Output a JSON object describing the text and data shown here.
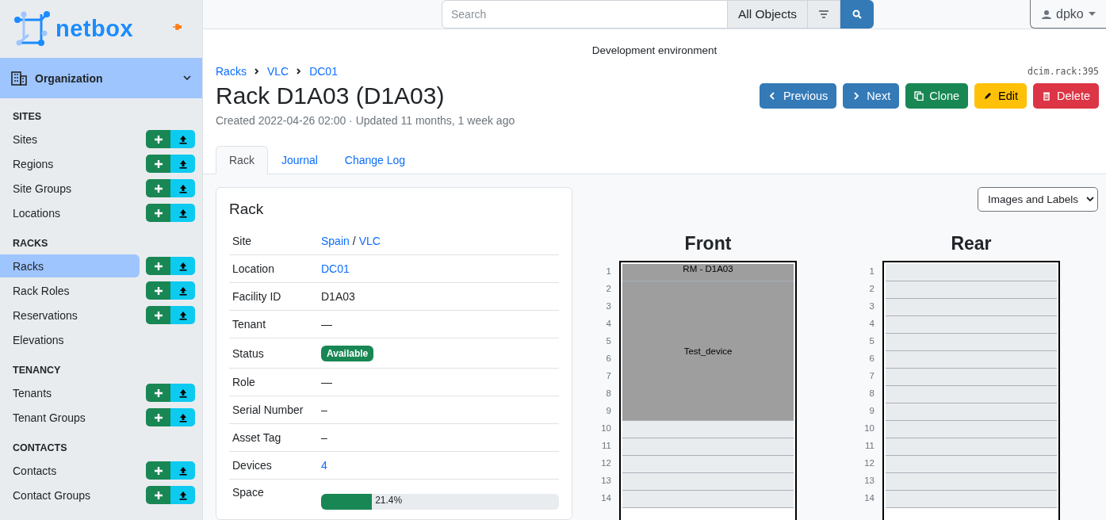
{
  "logo": {
    "text": "netbox"
  },
  "sidebar": {
    "menu": {
      "label": "Organization",
      "expanded": true
    },
    "sections": [
      {
        "heading": "SITES",
        "items": [
          {
            "label": "Sites",
            "selected": false,
            "actions": true
          },
          {
            "label": "Regions",
            "selected": false,
            "actions": true
          },
          {
            "label": "Site Groups",
            "selected": false,
            "actions": true
          },
          {
            "label": "Locations",
            "selected": false,
            "actions": true
          }
        ]
      },
      {
        "heading": "RACKS",
        "items": [
          {
            "label": "Racks",
            "selected": true,
            "actions": true
          },
          {
            "label": "Rack Roles",
            "selected": false,
            "actions": true
          },
          {
            "label": "Reservations",
            "selected": false,
            "actions": true
          },
          {
            "label": "Elevations",
            "selected": false,
            "actions": false
          }
        ]
      },
      {
        "heading": "TENANCY",
        "items": [
          {
            "label": "Tenants",
            "selected": false,
            "actions": true
          },
          {
            "label": "Tenant Groups",
            "selected": false,
            "actions": true
          }
        ]
      },
      {
        "heading": "CONTACTS",
        "items": [
          {
            "label": "Contacts",
            "selected": false,
            "actions": true
          },
          {
            "label": "Contact Groups",
            "selected": false,
            "actions": true
          }
        ]
      }
    ]
  },
  "search": {
    "placeholder": "Search",
    "scope": "All Objects"
  },
  "user": {
    "name": "dpko"
  },
  "banner": "Development environment",
  "breadcrumbs": [
    "Racks",
    "VLC",
    "DC01"
  ],
  "object_id": "dcim.rack:395",
  "title": "Rack D1A03 (D1A03)",
  "meta": "Created 2022-04-26 02:00 · Updated 11 months, 1 week ago",
  "actions": [
    {
      "label": "Previous",
      "kind": "previous"
    },
    {
      "label": "Next",
      "kind": "next"
    },
    {
      "label": "Clone",
      "kind": "clone"
    },
    {
      "label": "Edit",
      "kind": "edit"
    },
    {
      "label": "Delete",
      "kind": "delete"
    }
  ],
  "tabs": [
    {
      "label": "Rack",
      "selected": true
    },
    {
      "label": "Journal",
      "selected": false
    },
    {
      "label": "Change Log",
      "selected": false
    }
  ],
  "rack_card": {
    "title": "Rack",
    "rows": [
      {
        "label": "Site",
        "kind": "links",
        "links": [
          "Spain",
          "VLC"
        ],
        "separator": "/"
      },
      {
        "label": "Location",
        "kind": "link",
        "value": "DC01"
      },
      {
        "label": "Facility ID",
        "kind": "text",
        "value": "D1A03"
      },
      {
        "label": "Tenant",
        "kind": "text",
        "value": "—"
      },
      {
        "label": "Status",
        "kind": "badge",
        "value": "Available"
      },
      {
        "label": "Role",
        "kind": "text",
        "value": "—"
      },
      {
        "label": "Serial Number",
        "kind": "text",
        "value": "–"
      },
      {
        "label": "Asset Tag",
        "kind": "text",
        "value": "–"
      },
      {
        "label": "Devices",
        "kind": "link",
        "value": "4"
      },
      {
        "label": "Space",
        "kind": "progress",
        "level": 0.214,
        "reading": "21.4%"
      }
    ]
  },
  "elevation_mode": "Images and Labels",
  "elevations": [
    {
      "title": "Front",
      "slots": [
        {
          "kind": "device",
          "label": "RM - D1A03",
          "units": [
            "1"
          ]
        },
        {
          "kind": "device",
          "label": "Test_device",
          "units": [
            "2",
            "3",
            "4",
            "5",
            "6",
            "7",
            "8",
            "9"
          ]
        },
        {
          "kind": "empty",
          "units": [
            "10"
          ]
        },
        {
          "kind": "empty",
          "units": [
            "11"
          ]
        },
        {
          "kind": "empty",
          "units": [
            "12"
          ]
        },
        {
          "kind": "empty",
          "units": [
            "13"
          ]
        },
        {
          "kind": "empty",
          "units": [
            "14"
          ]
        }
      ]
    },
    {
      "title": "Rear",
      "slots": [
        {
          "kind": "empty",
          "units": [
            "1"
          ]
        },
        {
          "kind": "empty",
          "units": [
            "2"
          ]
        },
        {
          "kind": "empty",
          "units": [
            "3"
          ]
        },
        {
          "kind": "empty",
          "units": [
            "4"
          ]
        },
        {
          "kind": "empty",
          "units": [
            "5"
          ]
        },
        {
          "kind": "empty",
          "units": [
            "6"
          ]
        },
        {
          "kind": "empty",
          "units": [
            "7"
          ]
        },
        {
          "kind": "empty",
          "units": [
            "8"
          ]
        },
        {
          "kind": "empty",
          "units": [
            "9"
          ]
        },
        {
          "kind": "empty",
          "units": [
            "10"
          ]
        },
        {
          "kind": "empty",
          "units": [
            "11"
          ]
        },
        {
          "kind": "empty",
          "units": [
            "12"
          ]
        },
        {
          "kind": "empty",
          "units": [
            "13"
          ]
        },
        {
          "kind": "empty",
          "units": [
            "14"
          ]
        }
      ]
    }
  ]
}
